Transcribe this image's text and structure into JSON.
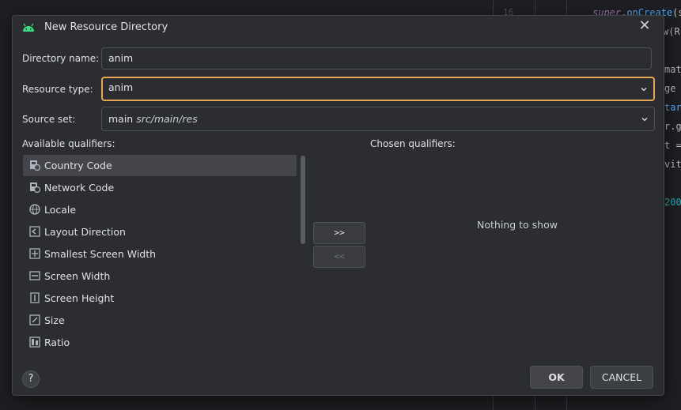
{
  "editor": {
    "line_number": "16",
    "code_lines": [
      {
        "parts": [
          {
            "t": "super",
            "c": "#9876aa"
          },
          {
            "t": ".",
            "c": "#bcbec4"
          },
          {
            "t": "onCreate",
            "c": "#56a8f5"
          },
          {
            "t": "(s",
            "c": "#bcbec4"
          }
        ]
      },
      {
        "parts": [
          {
            "t": "w(R",
            "c": "#bcbec4"
          }
        ]
      },
      {
        "parts": [
          {
            "t": "mat",
            "c": "#bcbec4"
          }
        ]
      },
      {
        "parts": [
          {
            "t": "ge",
            "c": "#bcbec4"
          }
        ]
      },
      {
        "parts": [
          {
            "t": "tar",
            "c": "#56a8f5"
          }
        ]
      },
      {
        "parts": [
          {
            "t": "r.g",
            "c": "#bcbec4"
          }
        ]
      },
      {
        "parts": [
          {
            "t": "t =",
            "c": "#bcbec4"
          }
        ]
      },
      {
        "parts": [
          {
            "t": "vit",
            "c": "#bcbec4"
          }
        ]
      },
      {
        "parts": [
          {
            "t": "200",
            "c": "#2aacb8"
          }
        ]
      }
    ]
  },
  "dialog": {
    "title": "New Resource Directory",
    "close_symbol": "✕",
    "directory_name": {
      "label": "Directory name:",
      "value": "anim"
    },
    "resource_type": {
      "label": "Resource type:",
      "value": "anim"
    },
    "source_set": {
      "label": "Source set:",
      "value_main": "main",
      "value_path": "src/main/res"
    },
    "available_label": "Available qualifiers:",
    "chosen_label": "Chosen qualifiers:",
    "qualifiers": [
      {
        "label": "Country Code",
        "icon": "country-code-icon",
        "selected": true
      },
      {
        "label": "Network Code",
        "icon": "network-code-icon",
        "selected": false
      },
      {
        "label": "Locale",
        "icon": "globe-icon",
        "selected": false
      },
      {
        "label": "Layout Direction",
        "icon": "layout-direction-icon",
        "selected": false
      },
      {
        "label": "Smallest Screen Width",
        "icon": "smallest-width-icon",
        "selected": false
      },
      {
        "label": "Screen Width",
        "icon": "screen-width-icon",
        "selected": false
      },
      {
        "label": "Screen Height",
        "icon": "screen-height-icon",
        "selected": false
      },
      {
        "label": "Size",
        "icon": "size-icon",
        "selected": false
      },
      {
        "label": "Ratio",
        "icon": "ratio-icon",
        "selected": false
      }
    ],
    "add_button": ">>",
    "remove_button": "<<",
    "nothing_to_show": "Nothing to show",
    "help_symbol": "?",
    "ok_label": "OK",
    "cancel_label": "CANCEL"
  },
  "colors": {
    "accent_focus": "#e6a856",
    "android_green": "#3ddc84",
    "dialog_bg": "#2b2d30"
  }
}
